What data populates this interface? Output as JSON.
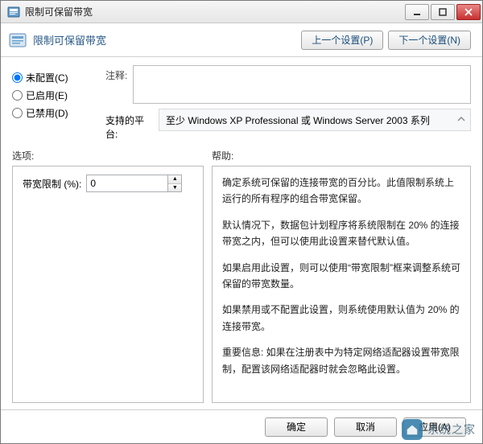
{
  "window": {
    "title": "限制可保留带宽"
  },
  "header": {
    "title": "限制可保留带宽",
    "prev_btn": "上一个设置(P)",
    "next_btn": "下一个设置(N)"
  },
  "radios": {
    "not_configured": "未配置(C)",
    "enabled": "已启用(E)",
    "disabled": "已禁用(D)",
    "selected": "not_configured"
  },
  "labels": {
    "comment": "注释:",
    "platform": "支持的平台:",
    "options": "选项:",
    "help": "帮助:"
  },
  "platform_text": "至少 Windows XP Professional 或 Windows Server 2003 系列",
  "option": {
    "label": "带宽限制 (%):",
    "value": "0"
  },
  "help_paragraphs": [
    "确定系统可保留的连接带宽的百分比。此值限制系统上运行的所有程序的组合带宽保留。",
    "默认情况下，数据包计划程序将系统限制在 20% 的连接带宽之内，但可以使用此设置来替代默认值。",
    "如果启用此设置，则可以使用“带宽限制”框来调整系统可保留的带宽数量。",
    "如果禁用或不配置此设置，则系统使用默认值为 20% 的连接带宽。",
    "重要信息: 如果在注册表中为特定网络适配器设置带宽限制，配置该网络适配器时就会忽略此设置。"
  ],
  "footer": {
    "ok": "确定",
    "cancel": "取消",
    "apply": "应用(A)"
  },
  "watermark": "系统之家"
}
